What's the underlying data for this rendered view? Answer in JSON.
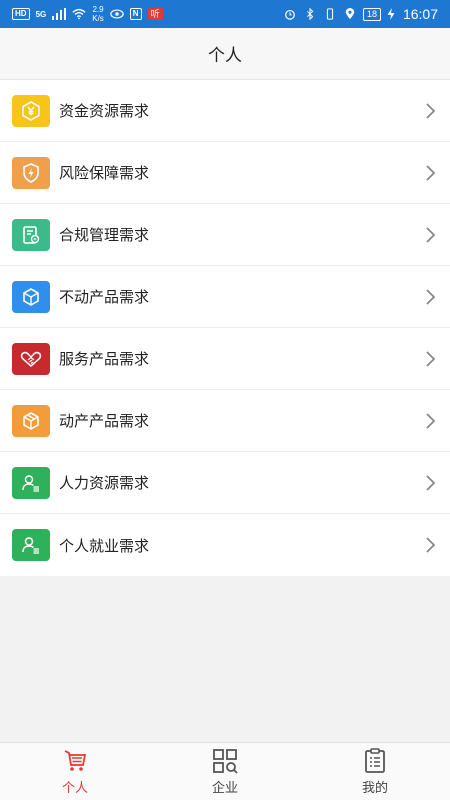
{
  "status_bar": {
    "hd": "HD",
    "net": "5G",
    "speed_value": "2.9",
    "speed_unit": "K/s",
    "n_label": "N",
    "red_badge": "听",
    "battery": "18",
    "time": "16:07"
  },
  "header": {
    "title": "个人"
  },
  "list": {
    "items": [
      {
        "label": "资金资源需求",
        "icon": "yuan-coin-icon",
        "color": "#f7c51a"
      },
      {
        "label": "风险保障需求",
        "icon": "shield-bolt-icon",
        "color": "#f0a04b"
      },
      {
        "label": "合规管理需求",
        "icon": "document-check-icon",
        "color": "#3dba8a"
      },
      {
        "label": "不动产品需求",
        "icon": "cube-icon",
        "color": "#2f8fea"
      },
      {
        "label": "服务产品需求",
        "icon": "handshake-icon",
        "color": "#c8282e"
      },
      {
        "label": "动产产品需求",
        "icon": "box-icon",
        "color": "#f39c3c"
      },
      {
        "label": "人力资源需求",
        "icon": "person-card-icon",
        "color": "#2fb05a"
      },
      {
        "label": "个人就业需求",
        "icon": "person-card-icon",
        "color": "#2fb05a"
      }
    ]
  },
  "bottom_nav": {
    "items": [
      {
        "label": "个人",
        "icon": "cart-icon",
        "active": true
      },
      {
        "label": "企业",
        "icon": "grid-search-icon",
        "active": false
      },
      {
        "label": "我的",
        "icon": "clipboard-list-icon",
        "active": false
      }
    ],
    "active_color": "#e53935"
  }
}
